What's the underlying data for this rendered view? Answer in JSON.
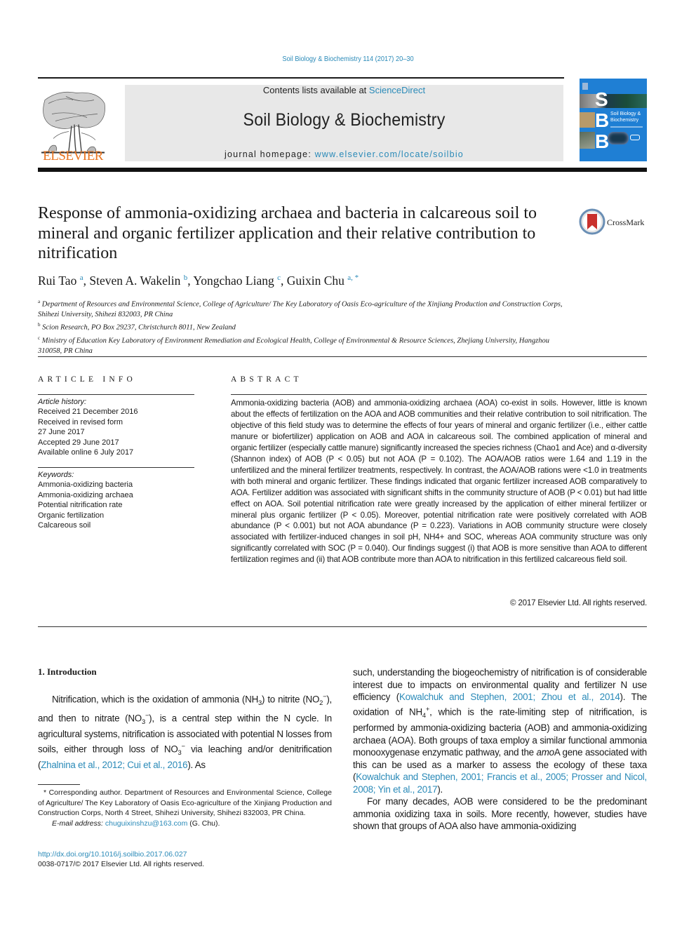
{
  "header": {
    "journal_ref": "Soil Biology & Biochemistry 114 (2017) 20–30",
    "contents_prefix": "Contents lists available at ",
    "contents_link": "ScienceDirect",
    "journal_title": "Soil Biology & Biochemistry",
    "homepage_prefix": "journal homepage: ",
    "homepage_link": "www.elsevier.com/locate/soilbio",
    "publisher_logo_text": "ELSEVIER",
    "cover_letters": [
      "S",
      "B",
      "B"
    ],
    "cover_title_line1": "Soil Biology &",
    "cover_title_line2": "Biochemistry",
    "crossmark_label": "CrossMark"
  },
  "article": {
    "title": "Response of ammonia-oxidizing archaea and bacteria in calcareous soil to mineral and organic fertilizer application and their relative contribution to nitrification",
    "authors": [
      {
        "name": "Rui Tao",
        "sup": "a"
      },
      {
        "name": "Steven A. Wakelin",
        "sup": "b"
      },
      {
        "name": "Yongchao Liang",
        "sup": "c"
      },
      {
        "name": "Guixin Chu",
        "sup": "a, *"
      }
    ],
    "affiliations": [
      {
        "key": "a",
        "text": "Department of Resources and Environmental Science, College of Agriculture/ The Key Laboratory of Oasis Eco-agriculture of the Xinjiang Production and Construction Corps, Shihezi University, Shihezi 832003, PR China"
      },
      {
        "key": "b",
        "text": "Scion Research, PO Box 29237, Christchurch 8011, New Zealand"
      },
      {
        "key": "c",
        "text": "Ministry of Education Key Laboratory of Environment Remediation and Ecological Health, College of Environmental & Resource Sciences, Zhejiang University, Hangzhou 310058, PR China"
      }
    ]
  },
  "article_info": {
    "heading": "ARTICLE INFO",
    "history_label": "Article history:",
    "history": [
      "Received 21 December 2016",
      "Received in revised form",
      "27 June 2017",
      "Accepted 29 June 2017",
      "Available online 6 July 2017"
    ],
    "keywords_label": "Keywords:",
    "keywords": [
      "Ammonia-oxidizing bacteria",
      "Ammonia-oxidizing archaea",
      "Potential nitrification rate",
      "Organic fertilization",
      "Calcareous soil"
    ]
  },
  "abstract": {
    "heading": "ABSTRACT",
    "text": "Ammonia-oxidizing bacteria (AOB) and ammonia-oxidizing archaea (AOA) co-exist in soils. However, little is known about the effects of fertilization on the AOA and AOB communities and their relative contribution to soil nitrification. The objective of this field study was to determine the effects of four years of mineral and organic fertilizer (i.e., either cattle manure or biofertilizer) application on AOB and AOA in calcareous soil. The combined application of mineral and organic fertilizer (especially cattle manure) significantly increased the species richness (Chao1 and Ace) and α-diversity (Shannon index) of AOB (P < 0.05) but not AOA (P = 0.102). The AOA/AOB ratios were 1.64 and 1.19 in the unfertilized and the mineral fertilizer treatments, respectively. In contrast, the AOA/AOB rations were <1.0 in treatments with both mineral and organic fertilizer. These findings indicated that organic fertilizer increased AOB comparatively to AOA. Fertilizer addition was associated with significant shifts in the community structure of AOB (P < 0.01) but had little effect on AOA. Soil potential nitrification rate were greatly increased by the application of either mineral fertilizer or mineral plus organic fertilizer (P < 0.05). Moreover, potential nitrification rate were positively correlated with AOB abundance (P < 0.001) but not AOA abundance (P = 0.223). Variations in AOB community structure were closely associated with fertilizer-induced changes in soil pH, NH4+ and SOC, whereas AOA community structure was only significantly correlated with SOC (P = 0.040). Our findings suggest (i) that AOB is more sensitive than AOA to different fertilization regimes and (ii) that AOB contribute more than AOA to nitrification in this fertilized calcareous field soil.",
    "copyright": "© 2017 Elsevier Ltd. All rights reserved."
  },
  "body": {
    "section_heading": "1.  Introduction",
    "left_para": {
      "t1": "Nitrification, which is the oxidation of ammonia (NH",
      "t2": ") to nitrite (NO",
      "t3": "), and then to nitrate (NO",
      "t4": "), is a central step within the N cycle. In agricultural systems, nitrification is associated with potential N losses from soils, either through loss of NO",
      "t5": " via leaching and/or denitrification (",
      "cite1": "Zhalnina et al., 2012; Cui et al., 2016",
      "t6": "). As"
    },
    "right_para1": {
      "t1": "such, understanding the biogeochemistry of nitrification is of considerable interest due to impacts on environmental quality and fertilizer N use efficiency (",
      "cite1": "Kowalchuk and Stephen, 2001; Zhou et al., 2014",
      "t2": "). The oxidation of NH",
      "t3": ", which is the rate-limiting step of nitrification, is performed by ammonia-oxidizing bacteria (AOB) and ammonia-oxidizing archaea (AOA). Both groups of taxa employ a similar functional ammonia monooxygenase enzymatic pathway, and the ",
      "gene": "amo",
      "t4": "A gene associated with this can be used as a marker to assess the ecology of these taxa (",
      "cite2": "Kowalchuk and Stephen, 2001; Francis et al., 2005; Prosser and Nicol, 2008; Yin et al., 2017",
      "t5": ")."
    },
    "right_para2": "For many decades, AOB were considered to be the predominant ammonia oxidizing taxa in soils. More recently, however, studies have shown that groups of AOA also have ammonia-oxidizing"
  },
  "footnote": {
    "corresponding": "* Corresponding author. Department of Resources and Environmental Science, College of Agriculture/ The Key Laboratory of Oasis Eco-agriculture of the Xinjiang Production and Construction Corps, North 4 Street, Shihezi University, Shihezi 832003, PR China.",
    "email_label": "E-mail address: ",
    "email": "chuguixinshzu@163.com",
    "email_suffix": " (G. Chu).",
    "doi": "http://dx.doi.org/10.1016/j.soilbio.2017.06.027",
    "issn": "0038-0717/© 2017 Elsevier Ltd. All rights reserved."
  },
  "colors": {
    "link": "#2a8ab8",
    "elsevier_orange": "#e8731f",
    "banner_gray": "#e8e8e8",
    "cover_blue": "#1f7fd4"
  }
}
